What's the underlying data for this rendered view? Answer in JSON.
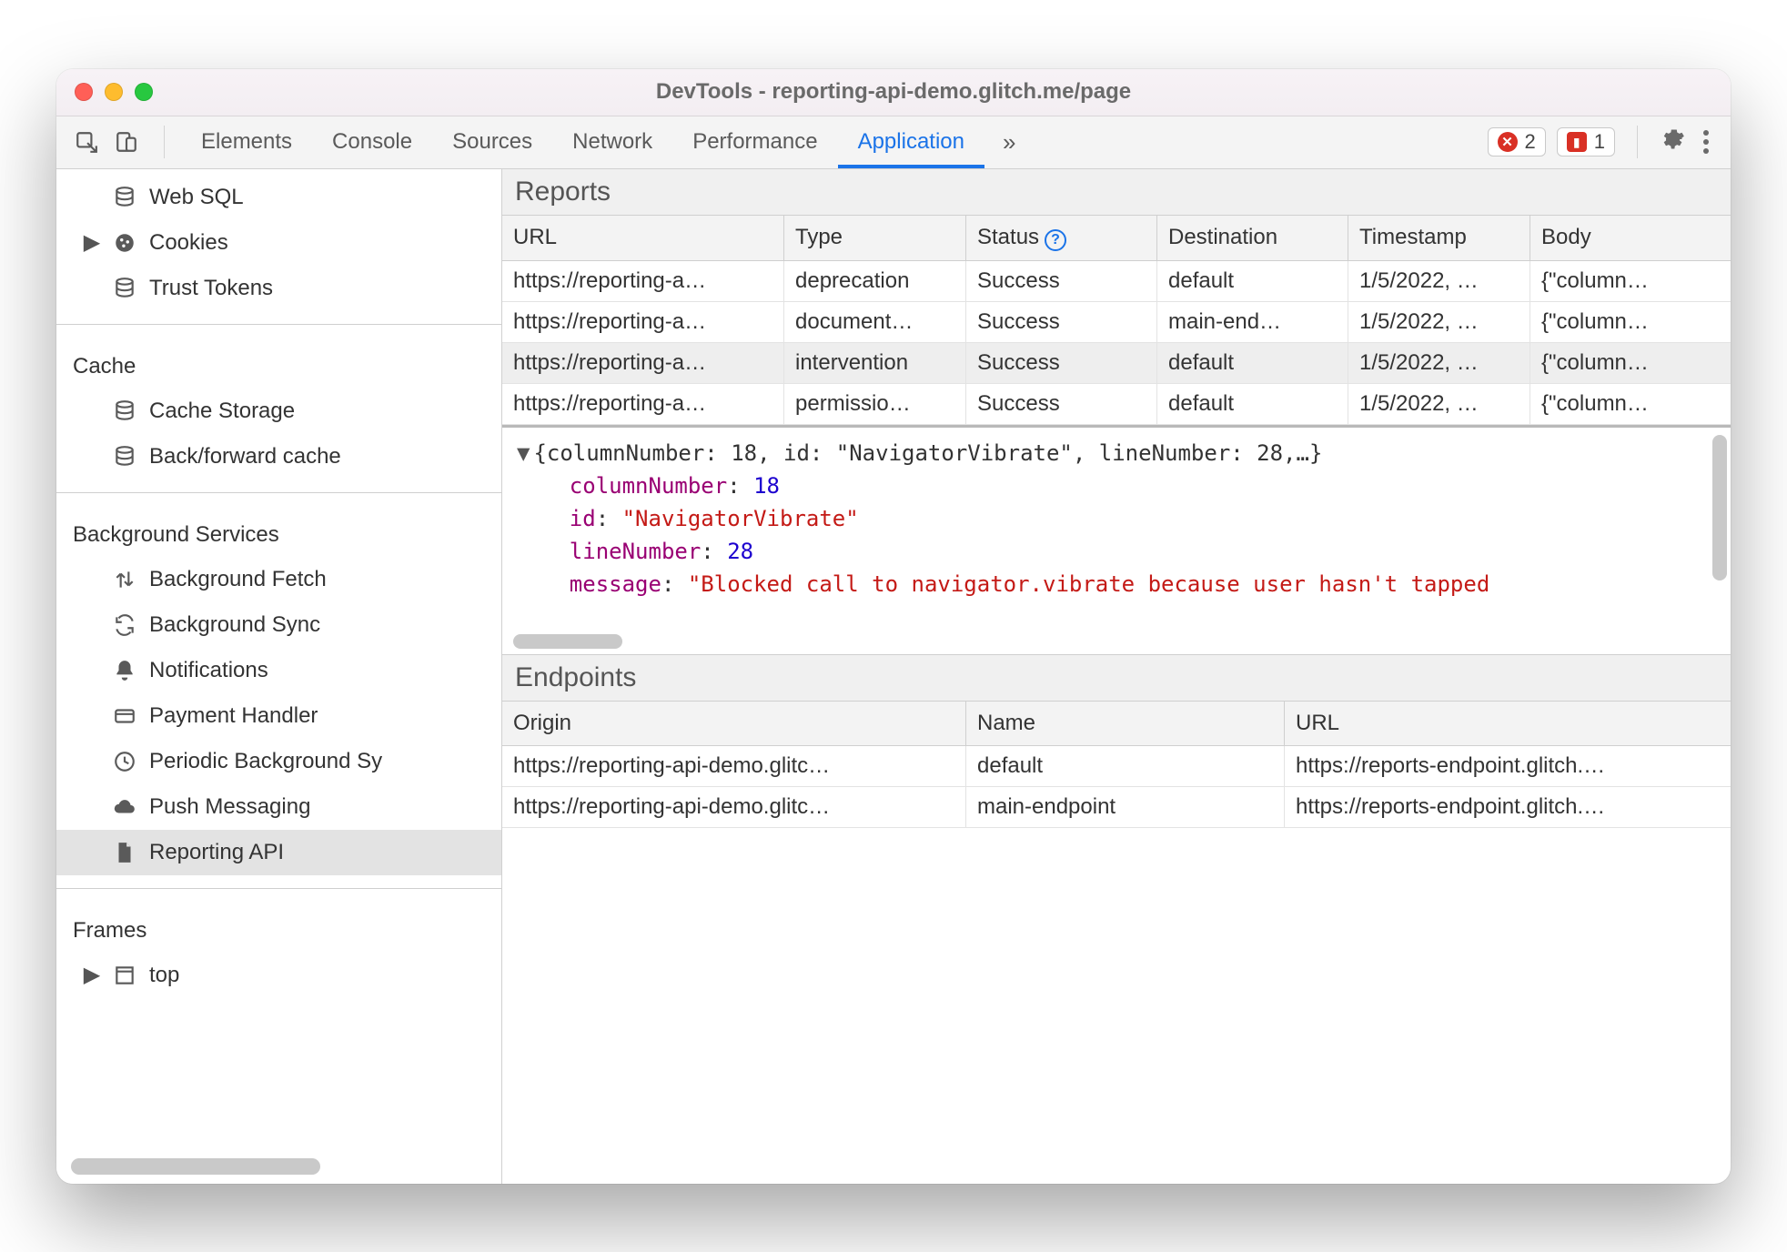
{
  "window": {
    "title": "DevTools - reporting-api-demo.glitch.me/page"
  },
  "toolbar": {
    "tabs": [
      "Elements",
      "Console",
      "Sources",
      "Network",
      "Performance",
      "Application"
    ],
    "active_tab": "Application",
    "errors_count": "2",
    "issues_count": "1"
  },
  "sidebar": {
    "storage_items": [
      {
        "icon": "database-icon",
        "label": "Web SQL"
      },
      {
        "icon": "cookie-icon",
        "label": "Cookies",
        "expandable": true
      },
      {
        "icon": "database-icon",
        "label": "Trust Tokens"
      }
    ],
    "cache_label": "Cache",
    "cache_items": [
      {
        "icon": "database-icon",
        "label": "Cache Storage"
      },
      {
        "icon": "database-icon",
        "label": "Back/forward cache"
      }
    ],
    "bg_label": "Background Services",
    "bg_items": [
      {
        "icon": "updown-icon",
        "label": "Background Fetch"
      },
      {
        "icon": "sync-icon",
        "label": "Background Sync"
      },
      {
        "icon": "bell-icon",
        "label": "Notifications"
      },
      {
        "icon": "card-icon",
        "label": "Payment Handler"
      },
      {
        "icon": "clock-icon",
        "label": "Periodic Background Sy"
      },
      {
        "icon": "cloud-icon",
        "label": "Push Messaging"
      },
      {
        "icon": "file-icon",
        "label": "Reporting API",
        "selected": true
      }
    ],
    "frames_label": "Frames",
    "frames_items": [
      {
        "icon": "frame-icon",
        "label": "top",
        "expandable": true
      }
    ]
  },
  "reports": {
    "title": "Reports",
    "headers": [
      "URL",
      "Type",
      "Status",
      "Destination",
      "Timestamp",
      "Body"
    ],
    "rows": [
      {
        "url": "https://reporting-a…",
        "type": "deprecation",
        "status": "Success",
        "dest": "default",
        "ts": "1/5/2022, …",
        "body": "{\"column…"
      },
      {
        "url": "https://reporting-a…",
        "type": "document…",
        "status": "Success",
        "dest": "main-end…",
        "ts": "1/5/2022, …",
        "body": "{\"column…"
      },
      {
        "url": "https://reporting-a…",
        "type": "intervention",
        "status": "Success",
        "dest": "default",
        "ts": "1/5/2022, …",
        "body": "{\"column…",
        "selected": true
      },
      {
        "url": "https://reporting-a…",
        "type": "permissio…",
        "status": "Success",
        "dest": "default",
        "ts": "1/5/2022, …",
        "body": "{\"column…"
      }
    ]
  },
  "detail": {
    "summary": "{columnNumber: 18, id: \"NavigatorVibrate\", lineNumber: 28,…}",
    "props": {
      "columnNumber": "18",
      "id": "\"NavigatorVibrate\"",
      "lineNumber": "28",
      "message_prefix": "\"Blocked call to navigator.vibrate because user hasn't tapped"
    }
  },
  "endpoints": {
    "title": "Endpoints",
    "headers": [
      "Origin",
      "Name",
      "URL"
    ],
    "rows": [
      {
        "origin": "https://reporting-api-demo.glitc…",
        "name": "default",
        "url": "https://reports-endpoint.glitch.…"
      },
      {
        "origin": "https://reporting-api-demo.glitc…",
        "name": "main-endpoint",
        "url": "https://reports-endpoint.glitch.…"
      }
    ]
  }
}
